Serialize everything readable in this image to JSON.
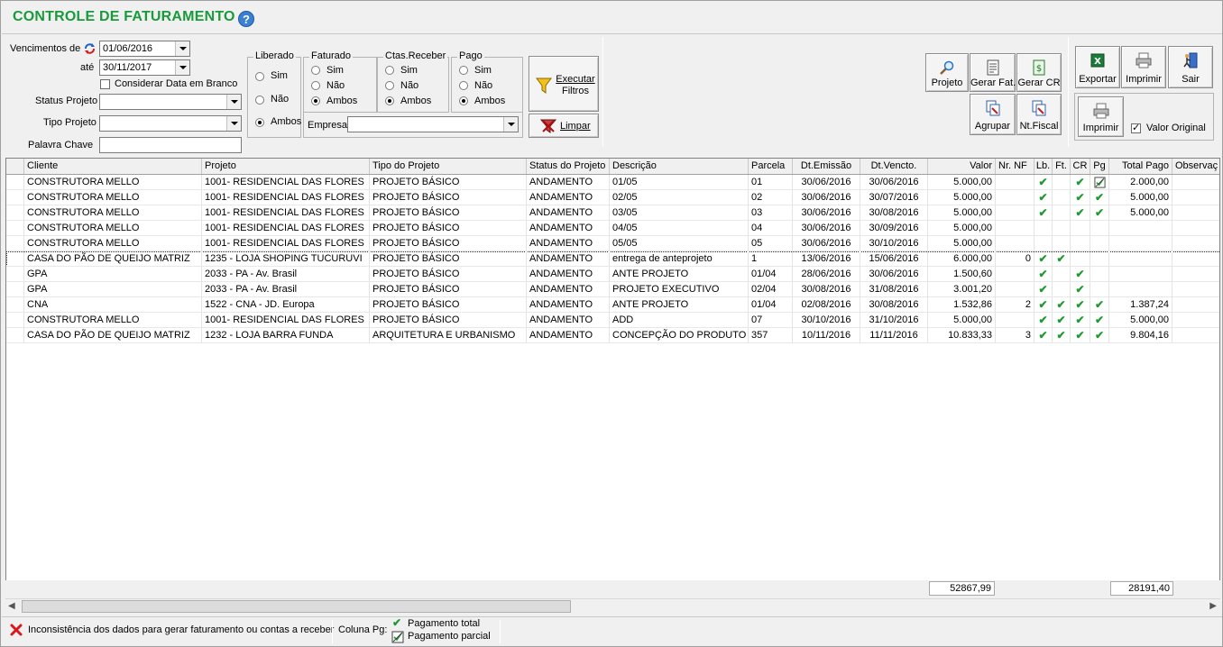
{
  "window": {
    "title": "CONTROLE DE FATURAMENTO",
    "help_glyph": "?"
  },
  "filters": {
    "vencimentos_label": "Vencimentos de",
    "date_from": "01/06/2016",
    "ate_label": "até",
    "date_to": "30/11/2017",
    "considerar_label": "Considerar Data em Branco",
    "status_projeto_label": "Status Projeto",
    "tipo_projeto_label": "Tipo Projeto",
    "palavra_chave_label": "Palavra Chave",
    "empresa_label": "Empresa"
  },
  "groups": {
    "liberado": {
      "title": "Liberado",
      "options": [
        "Sim",
        "Não",
        "Ambos"
      ]
    },
    "faturado": {
      "title": "Faturado",
      "options": [
        "Sim",
        "Não",
        "Ambos"
      ]
    },
    "ctas": {
      "title": "Ctas.Receber",
      "options": [
        "Sim",
        "Não",
        "Ambos"
      ]
    },
    "pago": {
      "title": "Pago",
      "options": [
        "Sim",
        "Não",
        "Ambos"
      ]
    }
  },
  "buttons": {
    "executar_1": "Executar",
    "executar_2": "Filtros",
    "limpar": "Limpar",
    "projeto": "Projeto",
    "gerar_fat": "Gerar Fat.",
    "gerar_cr": "Gerar CR",
    "agrupar": "Agrupar",
    "nt_fiscal": "Nt.Fiscal",
    "exportar": "Exportar",
    "imprimir_top": "Imprimir",
    "sair": "Sair",
    "imprimir_bottom": "Imprimir",
    "valor_original": "Valor Original"
  },
  "table": {
    "headers": [
      "Cliente",
      "Projeto",
      "Tipo do Projeto",
      "Status do Projeto",
      "Descrição",
      "Parcela",
      "Dt.Emissão",
      "Dt.Vencto.",
      "Valor",
      "Nr. NF",
      "Lb.",
      "Ft.",
      "CR",
      "Pg",
      "Total Pago",
      "Observaç"
    ],
    "rows": [
      {
        "cliente": "CONSTRUTORA MELLO",
        "projeto": "1001- RESIDENCIAL DAS FLORES",
        "tipo": "PROJETO BÁSICO",
        "status": "ANDAMENTO",
        "descricao": "01/05",
        "parcela": "01",
        "emissao": "30/06/2016",
        "vencto": "30/06/2016",
        "valor": "5.000,00",
        "nf": "",
        "lb": true,
        "ft": false,
        "cr": true,
        "pg": "parcial",
        "total": "2.000,00"
      },
      {
        "cliente": "CONSTRUTORA MELLO",
        "projeto": "1001- RESIDENCIAL DAS FLORES",
        "tipo": "PROJETO BÁSICO",
        "status": "ANDAMENTO",
        "descricao": "02/05",
        "parcela": "02",
        "emissao": "30/06/2016",
        "vencto": "30/07/2016",
        "valor": "5.000,00",
        "nf": "",
        "lb": true,
        "ft": false,
        "cr": true,
        "pg": "total",
        "total": "5.000,00"
      },
      {
        "cliente": "CONSTRUTORA MELLO",
        "projeto": "1001- RESIDENCIAL DAS FLORES",
        "tipo": "PROJETO BÁSICO",
        "status": "ANDAMENTO",
        "descricao": "03/05",
        "parcela": "03",
        "emissao": "30/06/2016",
        "vencto": "30/08/2016",
        "valor": "5.000,00",
        "nf": "",
        "lb": true,
        "ft": false,
        "cr": true,
        "pg": "total",
        "total": "5.000,00"
      },
      {
        "cliente": "CONSTRUTORA MELLO",
        "projeto": "1001- RESIDENCIAL DAS FLORES",
        "tipo": "PROJETO BÁSICO",
        "status": "ANDAMENTO",
        "descricao": "04/05",
        "parcela": "04",
        "emissao": "30/06/2016",
        "vencto": "30/09/2016",
        "valor": "5.000,00",
        "nf": "",
        "lb": false,
        "ft": false,
        "cr": false,
        "pg": "",
        "total": ""
      },
      {
        "cliente": "CONSTRUTORA MELLO",
        "projeto": "1001- RESIDENCIAL DAS FLORES",
        "tipo": "PROJETO BÁSICO",
        "status": "ANDAMENTO",
        "descricao": "05/05",
        "parcela": "05",
        "emissao": "30/06/2016",
        "vencto": "30/10/2016",
        "valor": "5.000,00",
        "nf": "",
        "lb": false,
        "ft": false,
        "cr": false,
        "pg": "",
        "total": ""
      },
      {
        "cliente": "CASA DO PÃO DE QUEIJO MATRIZ",
        "projeto": "1235 - LOJA SHOPING TUCURUVI",
        "tipo": "PROJETO BÁSICO",
        "status": "ANDAMENTO",
        "descricao": "entrega de anteprojeto",
        "parcela": "1",
        "emissao": "13/06/2016",
        "vencto": "15/06/2016",
        "valor": "6.000,00",
        "nf": "0",
        "lb": true,
        "ft": true,
        "cr": false,
        "pg": "",
        "total": "",
        "selected": true
      },
      {
        "cliente": "GPA",
        "projeto": "2033  - PA - Av. Brasil",
        "tipo": "PROJETO BÁSICO",
        "status": "ANDAMENTO",
        "descricao": "ANTE PROJETO",
        "parcela": "01/04",
        "emissao": "28/06/2016",
        "vencto": "30/06/2016",
        "valor": "1.500,60",
        "nf": "",
        "lb": true,
        "ft": false,
        "cr": true,
        "pg": "",
        "total": ""
      },
      {
        "cliente": "GPA",
        "projeto": "2033  - PA - Av. Brasil",
        "tipo": "PROJETO BÁSICO",
        "status": "ANDAMENTO",
        "descricao": "PROJETO EXECUTIVO",
        "parcela": "02/04",
        "emissao": "30/08/2016",
        "vencto": "31/08/2016",
        "valor": "3.001,20",
        "nf": "",
        "lb": true,
        "ft": false,
        "cr": true,
        "pg": "",
        "total": ""
      },
      {
        "cliente": "CNA",
        "projeto": "1522 - CNA - JD. Europa",
        "tipo": "PROJETO BÁSICO",
        "status": "ANDAMENTO",
        "descricao": "ANTE PROJETO",
        "parcela": "01/04",
        "emissao": "02/08/2016",
        "vencto": "30/08/2016",
        "valor": "1.532,86",
        "nf": "2",
        "lb": true,
        "ft": true,
        "cr": true,
        "pg": "total",
        "total": "1.387,24"
      },
      {
        "cliente": "CONSTRUTORA MELLO",
        "projeto": "1001- RESIDENCIAL DAS FLORES",
        "tipo": "PROJETO BÁSICO",
        "status": "ANDAMENTO",
        "descricao": "ADD",
        "parcela": "07",
        "emissao": "30/10/2016",
        "vencto": "31/10/2016",
        "valor": "5.000,00",
        "nf": "",
        "lb": true,
        "ft": true,
        "cr": true,
        "pg": "total",
        "total": "5.000,00"
      },
      {
        "cliente": "CASA DO PÃO DE QUEIJO MATRIZ",
        "projeto": "1232 - LOJA BARRA FUNDA",
        "tipo": "ARQUITETURA E URBANISMO",
        "status": "ANDAMENTO",
        "descricao": "CONCEPÇÃO DO PRODUTO",
        "parcela": "357",
        "emissao": "10/11/2016",
        "vencto": "11/11/2016",
        "valor": "10.833,33",
        "nf": "3",
        "lb": true,
        "ft": true,
        "cr": true,
        "pg": "total",
        "total": "9.804,16"
      }
    ],
    "total_valor": "52867,99",
    "total_pago": "28191,40"
  },
  "status": {
    "inconsistencia": "Inconsistência dos dados para gerar faturamento ou contas a receber",
    "coluna_pg": "Coluna Pg:",
    "pag_total": "Pagamento total",
    "pag_parcial": "Pagamento parcial"
  },
  "colors": {
    "title_green": "#1a9a3c",
    "check_green": "#1e9a30",
    "error_red": "#d8161b"
  }
}
